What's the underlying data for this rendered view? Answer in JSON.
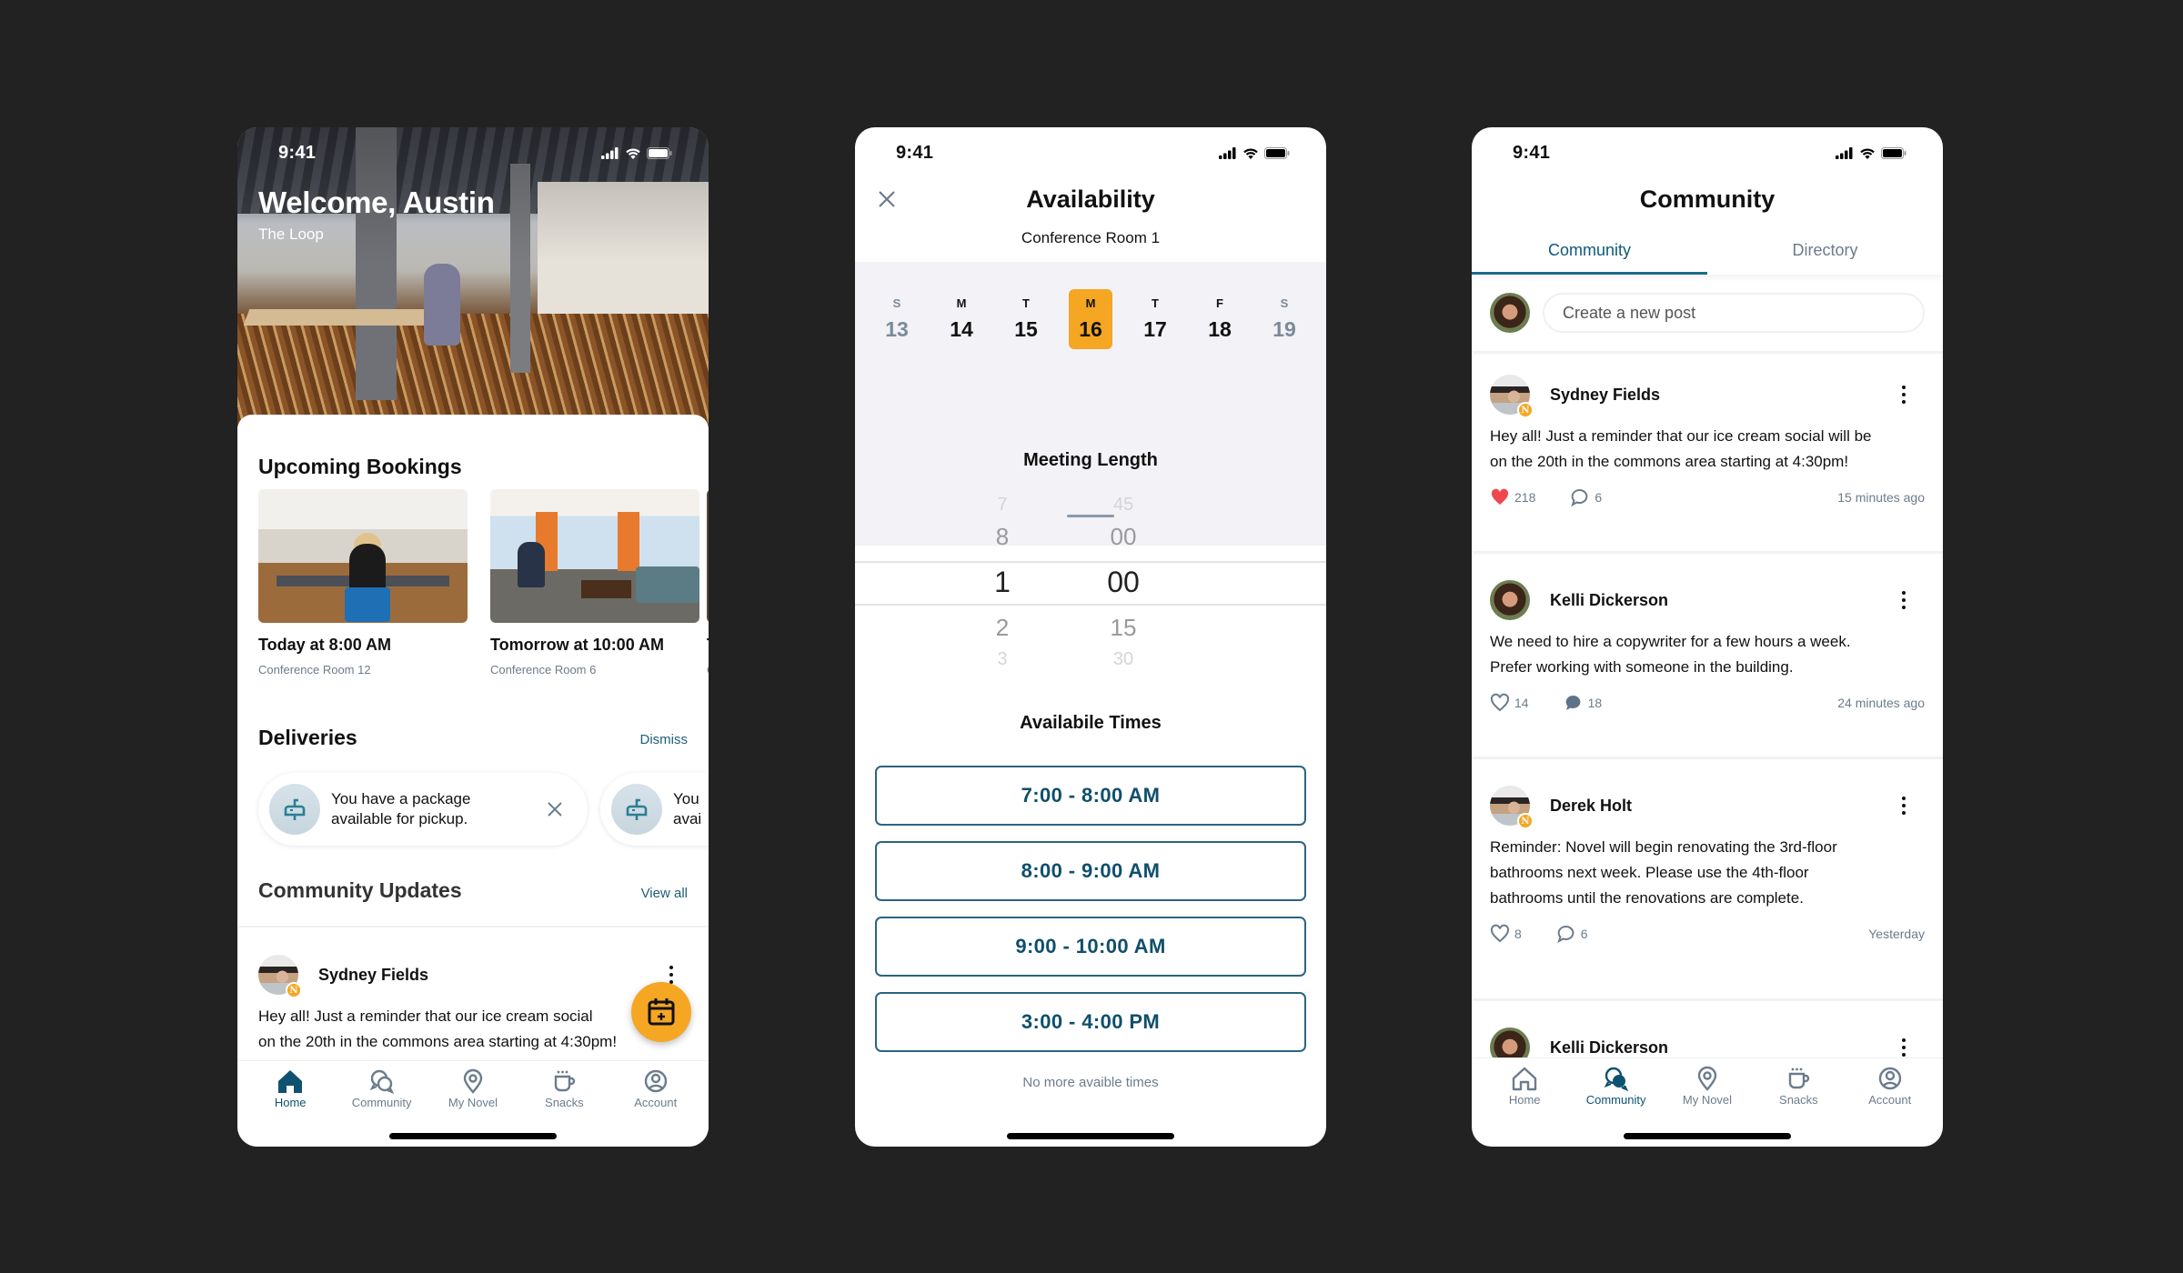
{
  "status_bar": {
    "time": "9:41"
  },
  "home": {
    "welcome_title": "Welcome, Austin",
    "location": "The Loop",
    "upcoming_bookings": {
      "title": "Upcoming Bookings",
      "items": [
        {
          "time": "Today at 8:00 AM",
          "room": "Conference Room 12"
        },
        {
          "time": "Tomorrow at 10:00 AM",
          "room": "Conference Room 6"
        },
        {
          "time": "T",
          "room": "C"
        }
      ]
    },
    "deliveries": {
      "title": "Deliveries",
      "dismiss_label": "Dismiss",
      "items": [
        {
          "icon": "mailbox-icon",
          "text_line1": "You have a package",
          "text_line2": "available for pickup."
        },
        {
          "icon": "mailbox-icon",
          "text_line1": "You",
          "text_line2": "avai"
        }
      ]
    },
    "community_updates": {
      "title": "Community Updates",
      "view_all_label": "View all",
      "post": {
        "author": "Sydney Fields",
        "badge": "N",
        "body_line1": "Hey all! Just a reminder that our ice cream social",
        "body_line2": "on the 20th in the commons area starting at 4:30pm!"
      }
    },
    "fab_icon": "calendar-plus-icon"
  },
  "tabbar": {
    "items": [
      {
        "label": "Home",
        "icon": "home-icon"
      },
      {
        "label": "Community",
        "icon": "chat-bubbles-icon"
      },
      {
        "label": "My Novel",
        "icon": "location-pin-icon"
      },
      {
        "label": "Snacks",
        "icon": "coffee-cup-icon"
      },
      {
        "label": "Account",
        "icon": "account-circle-icon"
      }
    ]
  },
  "availability": {
    "title": "Availability",
    "subtitle": "Conference Room 1",
    "days": [
      {
        "letter": "S",
        "num": "13",
        "weekend": true
      },
      {
        "letter": "M",
        "num": "14",
        "weekend": false
      },
      {
        "letter": "T",
        "num": "15",
        "weekend": false
      },
      {
        "letter": "M",
        "num": "16",
        "weekend": false,
        "selected": true
      },
      {
        "letter": "T",
        "num": "17",
        "weekend": false
      },
      {
        "letter": "F",
        "num": "18",
        "weekend": false
      },
      {
        "letter": "S",
        "num": "19",
        "weekend": true
      }
    ],
    "meeting_length_title": "Meeting Length",
    "hours": [
      "7",
      "8",
      "1",
      "2",
      "3"
    ],
    "minutes": [
      "45",
      "00",
      "00",
      "15",
      "30"
    ],
    "selected_hours": "1",
    "selected_minutes": "00",
    "available_times_title": "Availabile Times",
    "slots": [
      "7:00 - 8:00 AM",
      "8:00 - 9:00 AM",
      "9:00 - 10:00 AM",
      "3:00 - 4:00 PM"
    ],
    "no_more_label": "No more avaible times"
  },
  "community": {
    "title": "Community",
    "tabs": [
      {
        "label": "Community",
        "active": true
      },
      {
        "label": "Directory",
        "active": false
      }
    ],
    "new_post_placeholder": "Create a new post",
    "posts": [
      {
        "author": "Sydney Fields",
        "badge": "N",
        "body": [
          "Hey all! Just a reminder that our ice cream social will be",
          "on the 20th in the commons area starting at 4:30pm!"
        ],
        "likes": "218",
        "liked": true,
        "comments": "6",
        "commented": false,
        "time": "15 minutes ago"
      },
      {
        "author": "Kelli Dickerson",
        "badge": "",
        "body": [
          "We need to hire a copywriter for a few hours a week.",
          "Prefer working with someone in the building."
        ],
        "likes": "14",
        "liked": false,
        "comments": "18",
        "commented": true,
        "time": "24 minutes ago"
      },
      {
        "author": "Derek Holt",
        "badge": "N",
        "body": [
          "Reminder: Novel will begin renovating the 3rd-floor",
          "bathrooms next week. Please use the 4th-floor",
          "bathrooms until the renovations are complete."
        ],
        "likes": "8",
        "liked": false,
        "comments": "6",
        "commented": false,
        "time": "Yesterday"
      },
      {
        "author": "Kelli Dickerson",
        "badge": ""
      }
    ]
  },
  "colors": {
    "accent_orange": "#f5a623",
    "primary_teal": "#0f5270",
    "muted": "#6b7c8c",
    "like_red": "#f0474f",
    "background": "#222222"
  }
}
